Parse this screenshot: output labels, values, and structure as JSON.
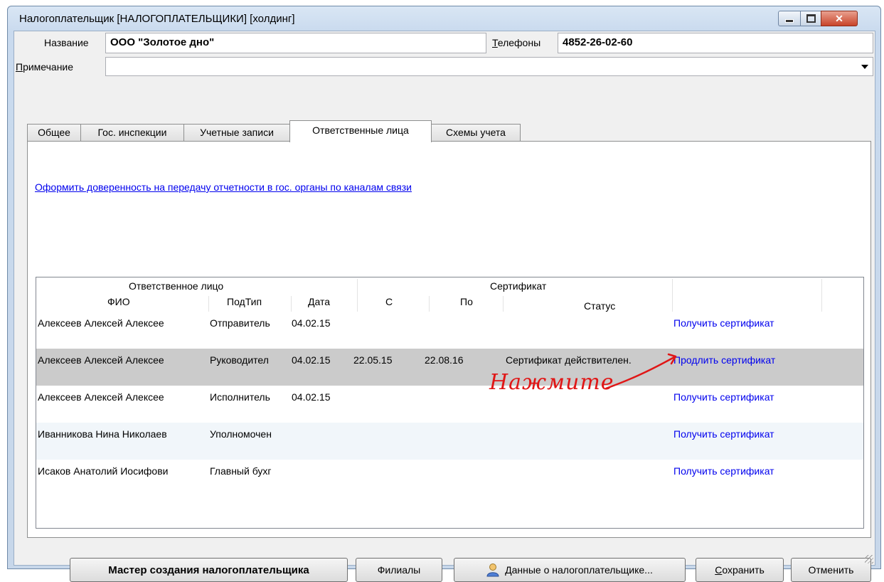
{
  "window": {
    "title": "Налогоплательщик [НАЛОГОПЛАТЕЛЬЩИКИ] [холдинг]",
    "close_glyph": "✕"
  },
  "form": {
    "name_label": "Название",
    "name_value": "ООО \"Золотое дно\"",
    "phones_label_prefix": "Т",
    "phones_label_rest": "елефоны",
    "phones_value": "4852-26-02-60",
    "note_label_prefix": "П",
    "note_label_rest": "римечание",
    "note_value": ""
  },
  "tabs": [
    {
      "label": "Общее"
    },
    {
      "label": "Гос. инспекции"
    },
    {
      "label": "Учетные записи"
    },
    {
      "label": "Ответственные лица"
    },
    {
      "label": "Схемы учета"
    }
  ],
  "link_power_of_attorney": "Оформить доверенность на передачу отчетности в гос. органы по каналам связи",
  "grid": {
    "group_responsible": "Ответственное лицо",
    "group_certificate": "Сертификат",
    "col_fio": "ФИО",
    "col_subtype": "ПодТип",
    "col_date": "Дата",
    "col_from": "С",
    "col_to": "По",
    "col_status": "Статус",
    "rows": [
      {
        "fio": "Алексеев Алексей Алексее",
        "subtype": "Отправитель",
        "date": "04.02.15",
        "from": "",
        "to": "",
        "status": "",
        "action": "Получить сертификат"
      },
      {
        "fio": "Алексеев Алексей Алексее",
        "subtype": "Руководител",
        "date": "04.02.15",
        "from": "22.05.15",
        "to": "22.08.16",
        "status": "Сертификат действителен.",
        "action": "Продлить сертификат"
      },
      {
        "fio": "Алексеев Алексей Алексее",
        "subtype": "Исполнитель",
        "date": "04.02.15",
        "from": "",
        "to": "",
        "status": "",
        "action": "Получить сертификат"
      },
      {
        "fio": "Иванникова Нина Николаев",
        "subtype": "Уполномочен",
        "date": "",
        "from": "",
        "to": "",
        "status": "",
        "action": "Получить сертификат"
      },
      {
        "fio": "Исаков Анатолий Иосифови",
        "subtype": "Главный бухг",
        "date": "",
        "from": "",
        "to": "",
        "status": "",
        "action": "Получить сертификат"
      }
    ]
  },
  "annotation": "Нажмите",
  "buttons": {
    "wizard": "Мастер создания налогоплательщика",
    "branches": "Филиалы",
    "taxpayer_data_prefix": "Д",
    "taxpayer_data_rest": "анные о налогоплательщике...",
    "save_prefix": "С",
    "save_rest": "охранить",
    "cancel": "Отменить"
  },
  "colors": {
    "link": "#0000ee",
    "annotation": "#e01616",
    "selected_row": "#cbcbcb"
  }
}
